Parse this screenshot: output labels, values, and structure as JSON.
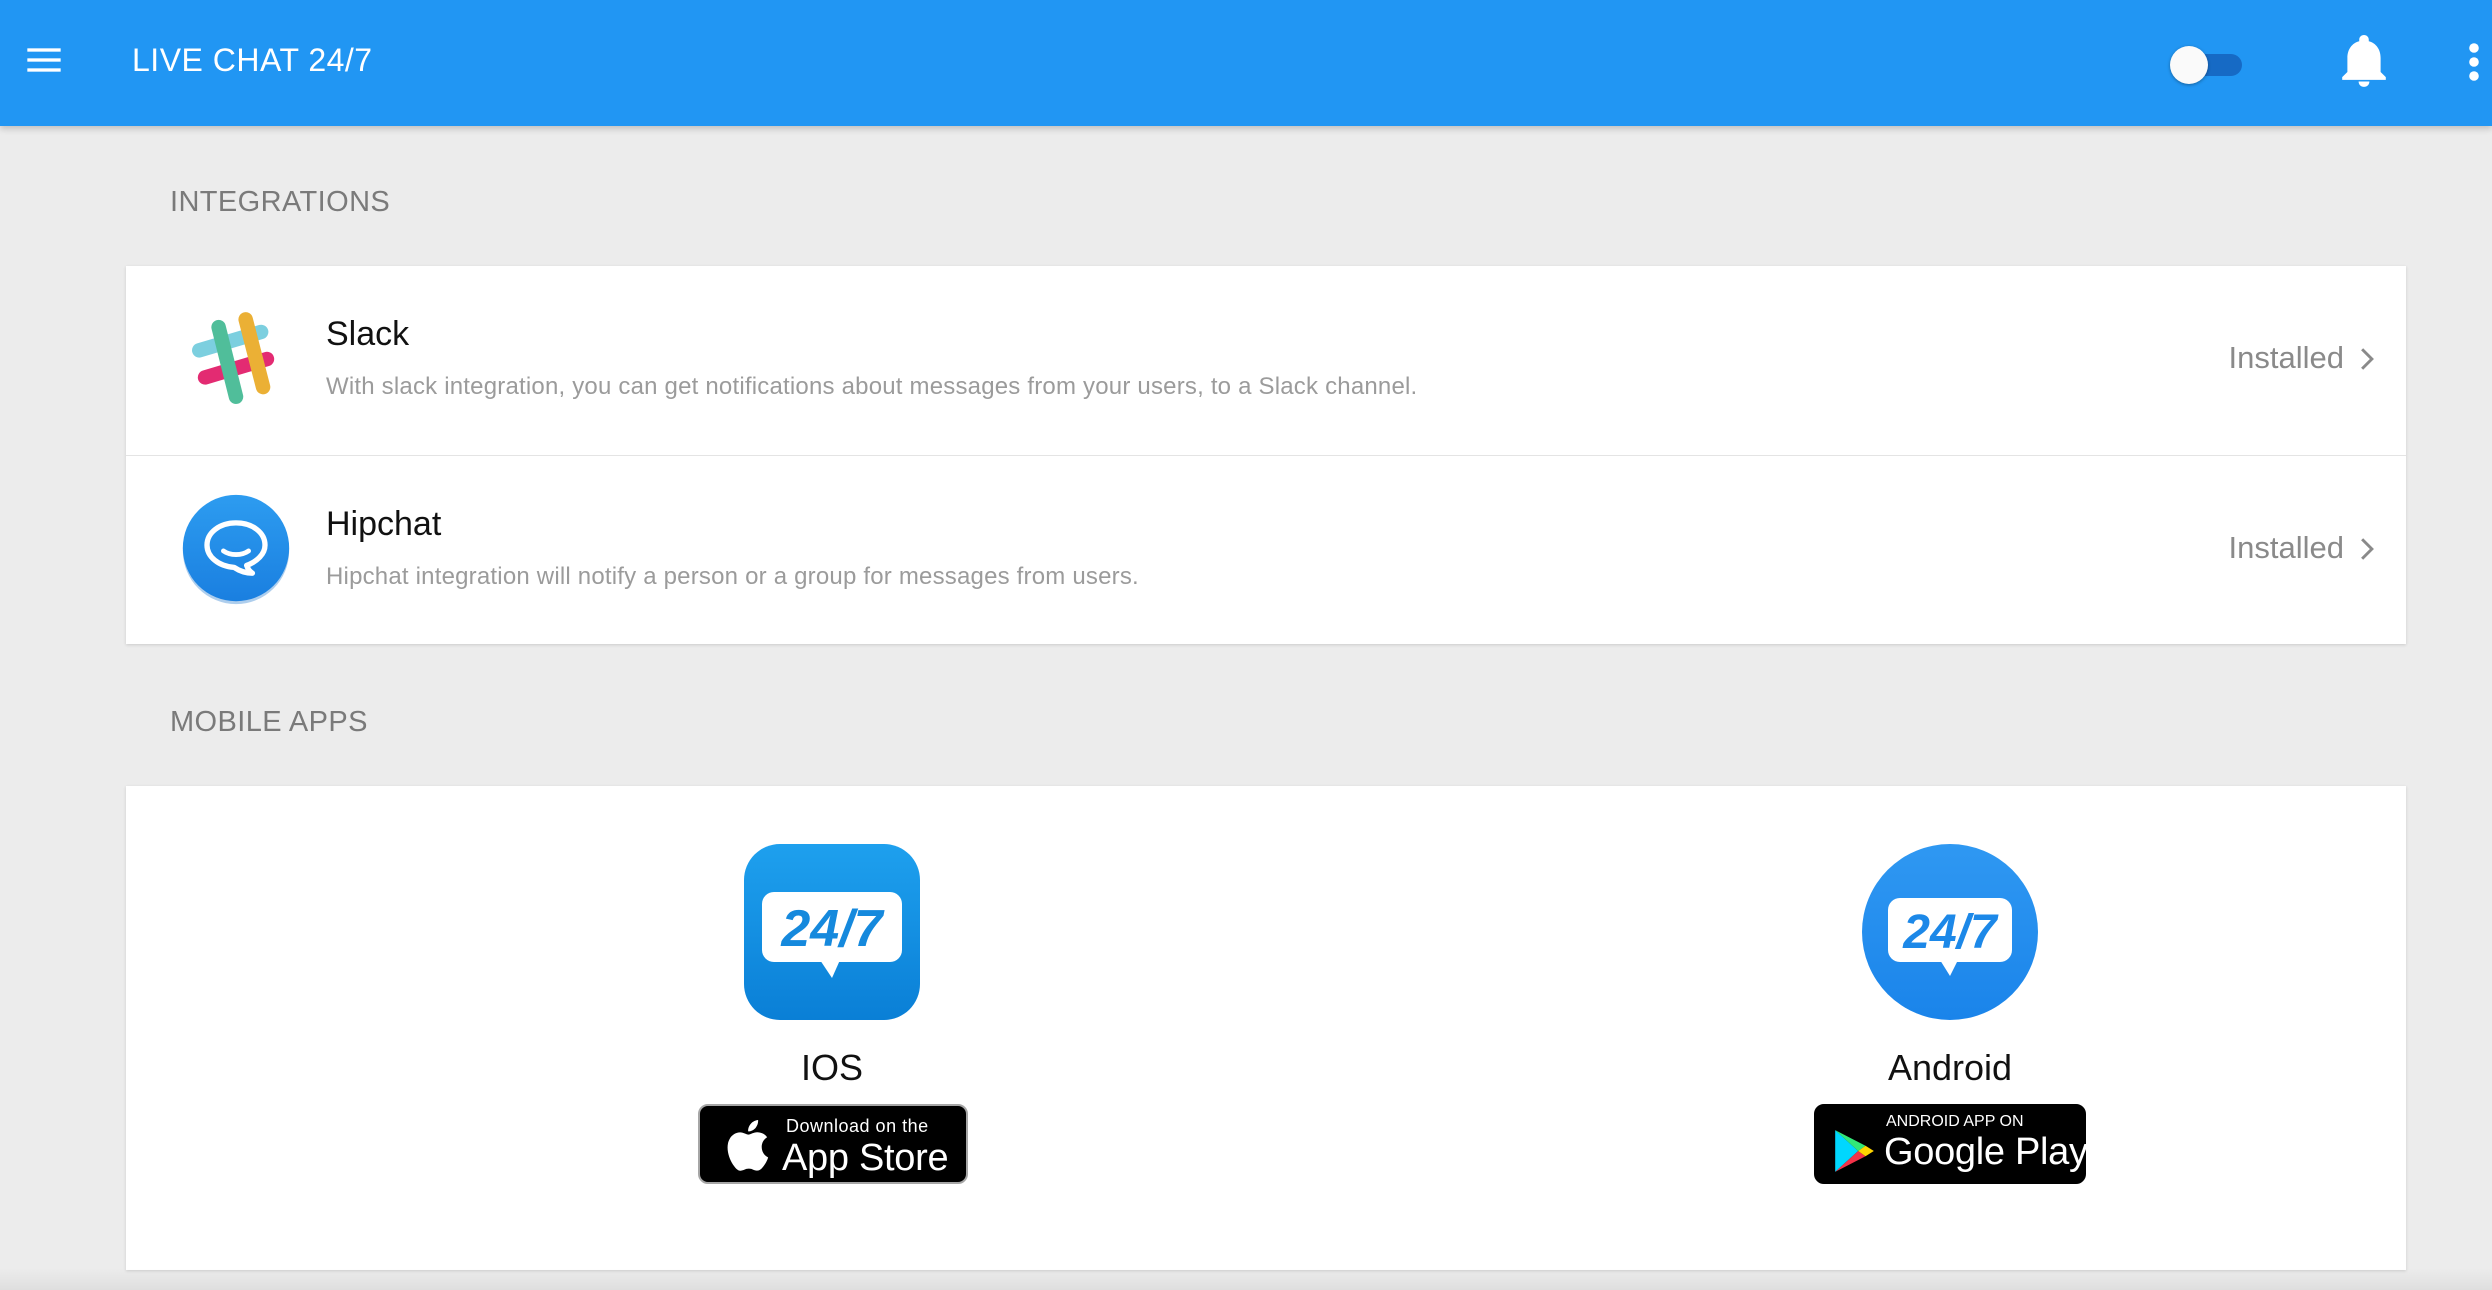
{
  "app_bar": {
    "title": "LIVE CHAT 24/7",
    "menu_icon": "hamburger-menu-icon",
    "toggle": {
      "state": "off"
    },
    "notification_icon": "bell-icon",
    "overflow_icon": "more-vert-icon",
    "color": "#2196f3"
  },
  "integrations": {
    "title": "INTEGRATIONS",
    "items": [
      {
        "icon": "slack-icon",
        "name": "Slack",
        "description": "With slack integration, you can get notifications about messages from your users, to a Slack channel.",
        "status": "Installed"
      },
      {
        "icon": "hipchat-icon",
        "name": "Hipchat",
        "description": "Hipchat integration will notify a person or a group for messages from users.",
        "status": "Installed"
      }
    ]
  },
  "mobile_apps": {
    "title": "MOBILE APPS",
    "apps": [
      {
        "platform": "IOS",
        "logo_text": "24/7",
        "badge_small": "Download on the",
        "badge_big": "App Store"
      },
      {
        "platform": "Android",
        "logo_text": "24/7",
        "badge_small": "ANDROID APP ON",
        "badge_big": "Google Play"
      }
    ]
  }
}
